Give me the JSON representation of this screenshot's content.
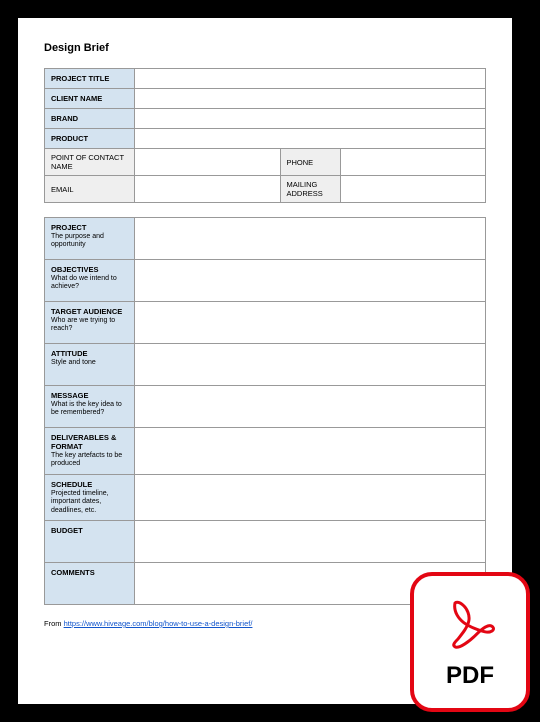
{
  "title": "Design Brief",
  "header_rows": [
    {
      "label": "PROJECT TITLE"
    },
    {
      "label": "CLIENT NAME"
    },
    {
      "label": "BRAND"
    },
    {
      "label": "PRODUCT"
    }
  ],
  "contact": {
    "point_of_contact": "POINT OF CONTACT NAME",
    "phone": "PHONE",
    "email": "EMAIL",
    "mailing_address": "MAILING ADDRESS"
  },
  "sections": [
    {
      "label": "PROJECT",
      "sub": "The purpose and opportunity"
    },
    {
      "label": "OBJECTIVES",
      "sub": "What do we intend to achieve?"
    },
    {
      "label": "TARGET AUDIENCE",
      "sub": "Who are we trying to reach?"
    },
    {
      "label": "ATTITUDE",
      "sub": "Style and tone"
    },
    {
      "label": "MESSAGE",
      "sub": "What is the key idea to be remembered?"
    },
    {
      "label": "DELIVERABLES & FORMAT",
      "sub": "The key artefacts to be produced"
    },
    {
      "label": "SCHEDULE",
      "sub": "Projected timeline, important dates, deadlines, etc."
    },
    {
      "label": "BUDGET",
      "sub": ""
    },
    {
      "label": "COMMENTS",
      "sub": ""
    }
  ],
  "footer": {
    "prefix": "From ",
    "url": "https://www.hiveage.com/blog/how-to-use-a-design-brief/"
  },
  "badge": {
    "text": "PDF"
  }
}
